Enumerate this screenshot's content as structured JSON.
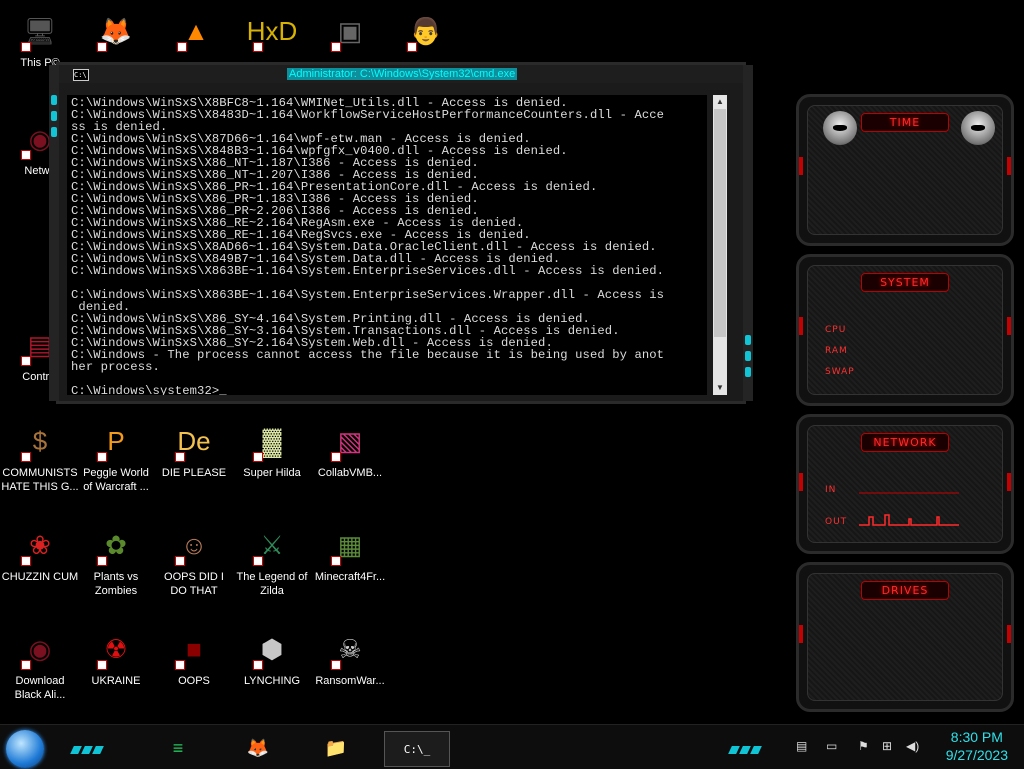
{
  "desktop_icons": [
    {
      "id": "this-pc",
      "label": "This P©",
      "glyph": "🖥"
    },
    {
      "id": "firefox",
      "label": "",
      "glyph": "🦊"
    },
    {
      "id": "vlc",
      "label": "",
      "glyph": "▲"
    },
    {
      "id": "hxd",
      "label": "",
      "glyph": "HxD"
    },
    {
      "id": "game-square",
      "label": "",
      "glyph": "▣"
    },
    {
      "id": "doctor",
      "label": "",
      "glyph": "👨"
    },
    {
      "id": "network",
      "label": "Netwo",
      "glyph": "◉"
    },
    {
      "id": "control-panel",
      "label": "Control",
      "glyph": "▤"
    },
    {
      "id": "communists",
      "label": "COMMUNISTS HATE THIS G...",
      "glyph": "$"
    },
    {
      "id": "peggle",
      "label": "Peggle World of Warcraft ...",
      "glyph": "P"
    },
    {
      "id": "die-please",
      "label": "DIE PLEASE",
      "glyph": "De"
    },
    {
      "id": "super-hilda",
      "label": "Super Hilda",
      "glyph": "▓"
    },
    {
      "id": "collabvmb",
      "label": "CollabVMB...",
      "glyph": "▧"
    },
    {
      "id": "chuzzin",
      "label": "CHUZZIN CUM",
      "glyph": "❀"
    },
    {
      "id": "plants-vs-zombies",
      "label": "Plants vs Zombies",
      "glyph": "✿"
    },
    {
      "id": "oops-did-i",
      "label": "OOPS DID I DO THAT",
      "glyph": "☺"
    },
    {
      "id": "legend-of-zilda",
      "label": "The Legend of Zilda",
      "glyph": "⚔"
    },
    {
      "id": "minecraft",
      "label": "Minecraft4Fr...",
      "glyph": "▦"
    },
    {
      "id": "download-black",
      "label": "Download Black Ali...",
      "glyph": "◉"
    },
    {
      "id": "ukraine",
      "label": "UKRAINE",
      "glyph": "☢"
    },
    {
      "id": "oops",
      "label": "OOPS",
      "glyph": "■"
    },
    {
      "id": "lynching",
      "label": "LYNCHING",
      "glyph": "⬢"
    },
    {
      "id": "ransomware",
      "label": "RansomWar...",
      "glyph": "☠"
    }
  ],
  "console": {
    "title": "Administrator: C:\\Windows\\System32\\cmd.exe",
    "icon_text": "C:\\",
    "lines": [
      "C:\\Windows\\WinSxS\\X8BFC8~1.164\\WMINet_Utils.dll - Access is denied.",
      "C:\\Windows\\WinSxS\\X8483D~1.164\\WorkflowServiceHostPerformanceCounters.dll - Acce",
      "ss is denied.",
      "C:\\Windows\\WinSxS\\X87D66~1.164\\wpf-etw.man - Access is denied.",
      "C:\\Windows\\WinSxS\\X848B3~1.164\\wpfgfx_v0400.dll - Access is denied.",
      "C:\\Windows\\WinSxS\\X86_NT~1.187\\I386 - Access is denied.",
      "C:\\Windows\\WinSxS\\X86_NT~1.207\\I386 - Access is denied.",
      "C:\\Windows\\WinSxS\\X86_PR~1.164\\PresentationCore.dll - Access is denied.",
      "C:\\Windows\\WinSxS\\X86_PR~1.183\\I386 - Access is denied.",
      "C:\\Windows\\WinSxS\\X86_PR~2.206\\I386 - Access is denied.",
      "C:\\Windows\\WinSxS\\X86_RE~2.164\\RegAsm.exe - Access is denied.",
      "C:\\Windows\\WinSxS\\X86_RE~1.164\\RegSvcs.exe - Access is denied.",
      "C:\\Windows\\WinSxS\\X8AD66~1.164\\System.Data.OracleClient.dll - Access is denied.",
      "C:\\Windows\\WinSxS\\X849B7~1.164\\System.Data.dll - Access is denied.",
      "C:\\Windows\\WinSxS\\X863BE~1.164\\System.EnterpriseServices.dll - Access is denied.",
      "",
      "C:\\Windows\\WinSxS\\X863BE~1.164\\System.EnterpriseServices.Wrapper.dll - Access is",
      " denied.",
      "C:\\Windows\\WinSxS\\X86_SY~4.164\\System.Printing.dll - Access is denied.",
      "C:\\Windows\\WinSxS\\X86_SY~3.164\\System.Transactions.dll - Access is denied.",
      "C:\\Windows\\WinSxS\\X86_SY~2.164\\System.Web.dll - Access is denied.",
      "C:\\Windows - The process cannot access the file because it is being used by anot",
      "her process.",
      "",
      "C:\\Windows\\system32>_"
    ]
  },
  "gadgets": {
    "time": {
      "title": "TIME"
    },
    "system": {
      "title": "SYSTEM",
      "rows": [
        "CPU",
        "RAM",
        "SWAP"
      ]
    },
    "network": {
      "title": "NETWORK",
      "rows": [
        "IN",
        "OUT"
      ]
    },
    "drives": {
      "title": "DRIVES"
    }
  },
  "taskbar": {
    "apps": [
      {
        "id": "notes-app",
        "glyph": "≡",
        "color": "#22c55e"
      },
      {
        "id": "firefox-app",
        "glyph": "🦊",
        "color": "#ff7a1a"
      },
      {
        "id": "explorer-app",
        "glyph": "📁",
        "color": "#f2c14e"
      },
      {
        "id": "cmd-app",
        "glyph": "C:\\_",
        "color": "#ffffff"
      }
    ],
    "clock_time": "8:30 PM",
    "clock_date": "9/27/2023"
  },
  "colors": {
    "accent_cyan": "#11c5d6",
    "gadget_red": "#ff2a2a",
    "console_text": "#dcdcdc"
  }
}
